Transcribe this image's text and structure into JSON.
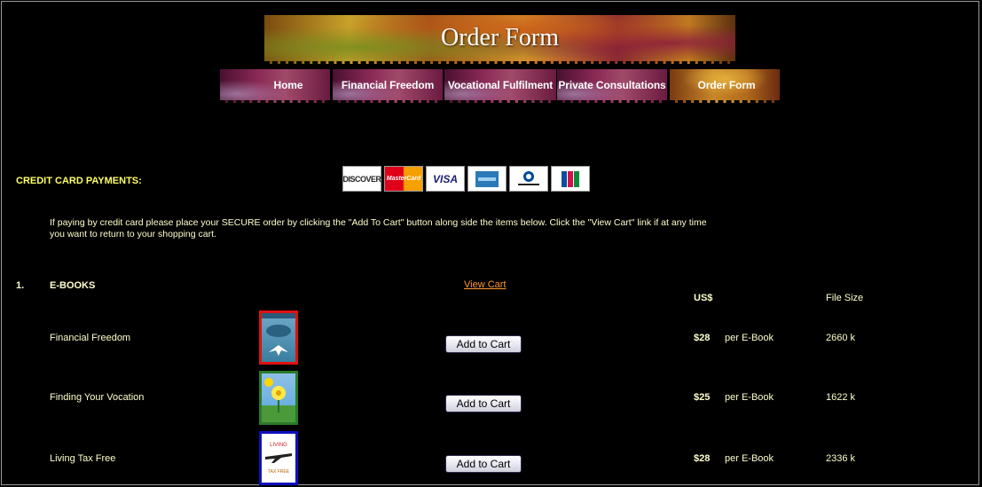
{
  "banner": {
    "title": "Order Form"
  },
  "nav": [
    {
      "label": "Home"
    },
    {
      "label": "Financial Freedom"
    },
    {
      "label": "Vocational Fulfilment"
    },
    {
      "label": "Private Consultations"
    },
    {
      "label": "Order Form"
    }
  ],
  "payments": {
    "label": "CREDIT CARD PAYMENTS:",
    "cards": [
      "DISCOVER",
      "MasterCard",
      "VISA",
      "American Express",
      "Diners Club International",
      "JCB"
    ],
    "instructions": "If paying by credit card please place your SECURE order by clicking the \"Add To Cart\" button along side the items below. Click the \"View Cart\" link if at any time you want to return to your shopping cart."
  },
  "section": {
    "number": "1.",
    "title": "E-BOOKS",
    "view_cart": "View Cart",
    "price_header": "US$",
    "size_header": "File Size"
  },
  "products": [
    {
      "title": "Financial Freedom",
      "button": "Add to Cart",
      "price": "$28",
      "unit": "per E-Book",
      "size": "2660 k",
      "cover_color": "#e01010"
    },
    {
      "title": "Finding Your Vocation",
      "button": "Add to Cart",
      "price": "$25",
      "unit": "per E-Book",
      "size": "1622 k",
      "cover_color": "#2a7a2a"
    },
    {
      "title": "Living Tax Free",
      "button": "Add to Cart",
      "price": "$28",
      "unit": "per E-Book",
      "size": "2336 k",
      "cover_color": "#1010c0"
    }
  ],
  "cover_art": {
    "living_word": "LIVING",
    "tax_word": "TAX FREE"
  }
}
